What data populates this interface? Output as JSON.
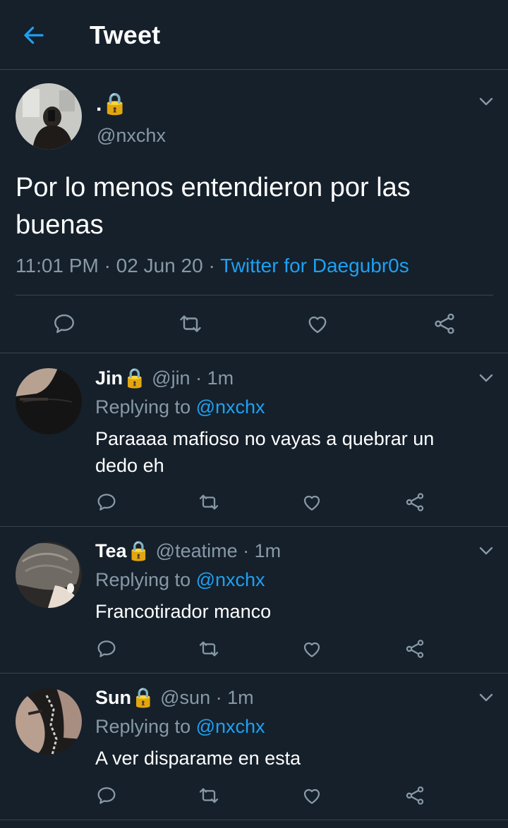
{
  "header": {
    "title": "Tweet"
  },
  "main_tweet": {
    "display_name": ".🔒",
    "handle": "@nxchx",
    "text_line1": "Por lo menos entendieron por las",
    "text_line2": "buenas",
    "time": "11:01 PM",
    "sep1": "·",
    "date": "02 Jun 20",
    "sep2": "·",
    "source": "Twitter for Daegubr0s"
  },
  "replies": [
    {
      "name": "Jin",
      "lock": "🔒",
      "handle": "@jin",
      "age": "· 1m",
      "replying_label": "Replying to",
      "replying_handle": "@nxchx",
      "text_line1": "Paraaaa mafioso no vayas a quebrar un",
      "text_line2": "dedo eh"
    },
    {
      "name": "Tea",
      "lock": "🔒",
      "handle": "@teatime",
      "age": "· 1m",
      "replying_label": "Replying to",
      "replying_handle": "@nxchx",
      "text_line1": "Francotirador manco"
    },
    {
      "name": "Sun",
      "lock": "🔒",
      "handle": "@sun",
      "age": "· 1m",
      "replying_label": "Replying to",
      "replying_handle": "@nxchx",
      "text_line1": "A ver disparame en esta"
    }
  ],
  "colors": {
    "background": "#15202b",
    "divider": "#38444d",
    "muted": "#8899a6",
    "accent": "#1da1f2"
  },
  "icons": [
    "back-arrow-icon",
    "chevron-down-icon",
    "reply-icon",
    "retweet-icon",
    "like-icon",
    "share-icon",
    "lock-icon"
  ]
}
